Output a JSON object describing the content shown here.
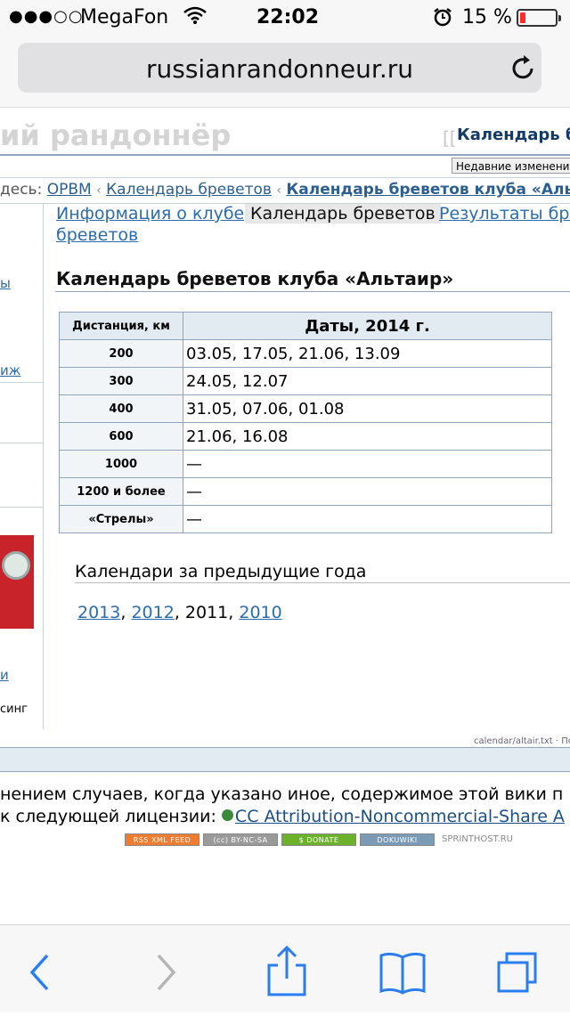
{
  "status": {
    "signal": "●●●○○",
    "carrier": "MegaFon",
    "time": "22:02",
    "battery_pct": "15 %",
    "battery_level": 0.15,
    "battery_color": "#ff2a2a"
  },
  "browser": {
    "url": "russianrandonneur.ru",
    "reload_icon": "reload-icon",
    "toolbar": [
      "back-icon",
      "forward-icon",
      "share-icon",
      "bookmarks-icon",
      "tabs-icon"
    ]
  },
  "site": {
    "title": "ий рандоннёр",
    "top_link_bracket": "[[",
    "top_link": "Календарь бре",
    "recent_changes": "Недавние изменения"
  },
  "breadcrumb": {
    "label": "десь:",
    "items": [
      "ОРВМ",
      "Календарь бреветов",
      "Календарь бреветов клуба «Альтаир"
    ],
    "sep": "‹"
  },
  "sidebar": {
    "texts": [
      "ы",
      "иж",
      "и",
      "синг"
    ]
  },
  "tabs": [
    {
      "label": "Информация о клубе",
      "active": false
    },
    {
      "label": "Календарь бреветов",
      "active": true
    },
    {
      "label": "Результаты бре",
      "active": false
    }
  ],
  "tabs_wrap": "бреветов",
  "heading": "Календарь бреветов клуба «Альтаир»",
  "table": {
    "headers": [
      "Дистанция, км",
      "Даты, 2014 г."
    ],
    "rows": [
      [
        "200",
        "03.05, 17.05, 21.06, 13.09"
      ],
      [
        "300",
        "24.05, 12.07"
      ],
      [
        "400",
        "31.05, 07.06, 01.08"
      ],
      [
        "600",
        "21.06, 16.08"
      ],
      [
        "1000",
        "—"
      ],
      [
        "1200 и более",
        "—"
      ],
      [
        "«Стрелы»",
        "—"
      ]
    ]
  },
  "previous": {
    "title": "Календари за предыдущие года",
    "years": [
      {
        "label": "2013",
        "link": true
      },
      {
        "label": "2012",
        "link": true
      },
      {
        "label": "2011",
        "link": false
      },
      {
        "label": "2010",
        "link": true
      }
    ]
  },
  "footnote": "calendar/altair.txt · По",
  "license": {
    "line1": "нением случаев, когда указано иное, содержимое этой вики п",
    "line2_prefix": "к следующей лицензии: ",
    "line2_link": "CC Attribution-Noncommercial-Share A"
  },
  "badges": [
    {
      "label": "RSS XML FEED",
      "color": "#f07c30"
    },
    {
      "label": "(cc) BY-NC-SA",
      "color": "#9a9a9a"
    },
    {
      "label": "$ DONATE",
      "color": "#6bb22a"
    },
    {
      "label": "DOKUWIKI",
      "color": "#7a9ab5"
    },
    {
      "label": "SPRINTHOST.RU",
      "color": "#888888"
    }
  ]
}
